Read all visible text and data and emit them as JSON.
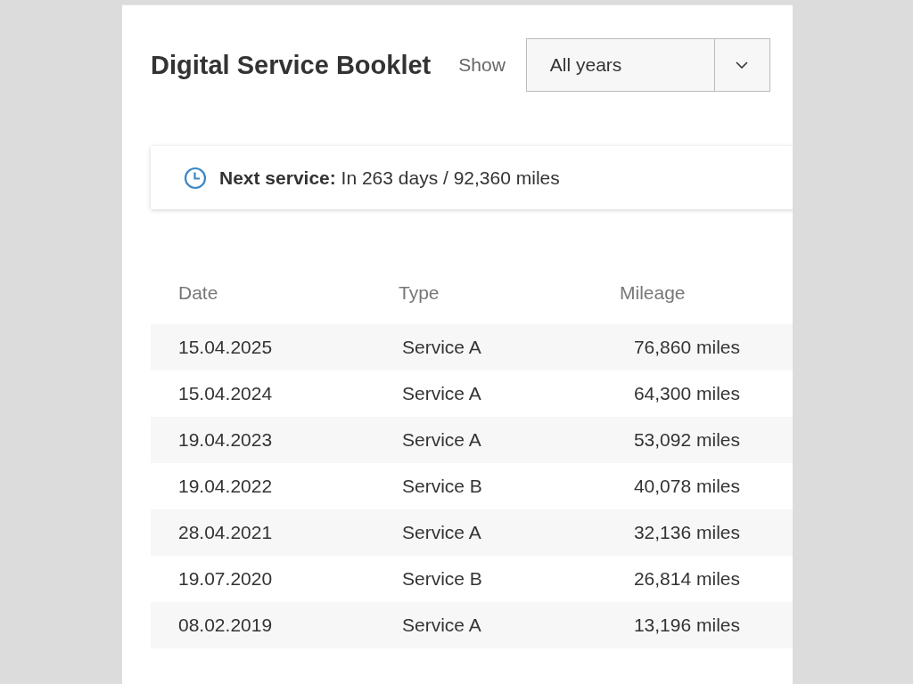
{
  "header": {
    "title": "Digital Service Booklet",
    "filter_label": "Show",
    "filter": {
      "value": "All years"
    }
  },
  "next_service": {
    "text": "**Next service:** In 263 days / 92,360 miles"
  },
  "table": {
    "columns": [
      "Date",
      "Type",
      "Mileage"
    ],
    "rows": [
      {
        "date": "15.04.2025",
        "type": "Service A",
        "mileage": "76,860 miles"
      },
      {
        "date": "15.04.2024",
        "type": "Service A",
        "mileage": "64,300 miles"
      },
      {
        "date": "19.04.2023",
        "type": "Service A",
        "mileage": "53,092 miles"
      },
      {
        "date": "19.04.2022",
        "type": "Service B",
        "mileage": "40,078 miles"
      },
      {
        "date": "28.04.2021",
        "type": "Service A",
        "mileage": "32,136 miles"
      },
      {
        "date": "19.07.2020",
        "type": "Service B",
        "mileage": "26,814 miles"
      },
      {
        "date": "08.02.2019",
        "type": "Service A",
        "mileage": "13,196 miles"
      }
    ]
  }
}
